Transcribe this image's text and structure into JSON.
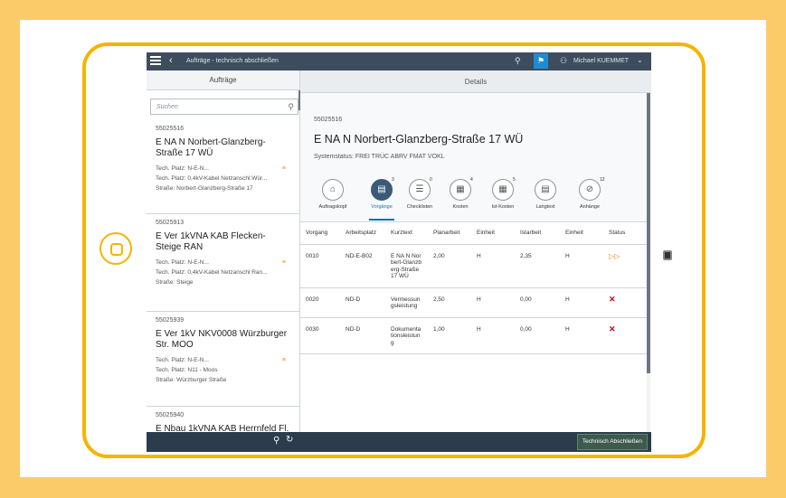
{
  "shell": {
    "title": "Aufträge - technisch abschließen",
    "user": "Michael KUEMMET",
    "back_icon": "chevron-left-icon",
    "flag_icon": "flag-icon"
  },
  "master": {
    "header": "Aufträge",
    "search_placeholder": "Suchen",
    "items": [
      {
        "num": "55025516",
        "title": "E NA N Norbert-Glanzberg-Straße 17 WÜ",
        "l1": "Tech. Platz: N-E-N...",
        "l2": "Tech. Platz: 0,4kV-Kabel Netzanschl.Wür...",
        "l3": "Straße: Norbert-Glanzberg-Straße 17",
        "ord": "≡"
      },
      {
        "num": "55025913",
        "title": "E Ver 1kVNA KAB Flecken-Steige RAN",
        "l1": "Tech. Platz: N-E-N...",
        "l2": "Tech. Platz: 0,4kV-Kabel Netzanschl Ran...",
        "l3": "Straße: Steige",
        "ord": "≡"
      },
      {
        "num": "55025939",
        "title": "E Ver 1kV NKV0008 Würzburger Str. MOO",
        "l1": "Tech. Platz: N-E-N...",
        "l2": "Tech. Platz: N11 - Moos",
        "l3": "Straße: Würzburger Straße",
        "ord": "≡"
      },
      {
        "num": "55025940",
        "title": "E Nbau 1kVNA KAB Herrnfeld Fl.",
        "l1": "",
        "l2": "",
        "l3": "",
        "ord": ""
      }
    ]
  },
  "detail": {
    "header": "Details",
    "number": "55025516",
    "title": "E NA N Norbert-Glanzberg-Straße 17 WÜ",
    "status": "Systemstatus: FREI TRÜC ABRV FMAT VOKL",
    "tabs": [
      {
        "label": "Auftragskopf",
        "count": "",
        "icon": "⌂"
      },
      {
        "label": "Vorgänge",
        "count": "3",
        "icon": "▤"
      },
      {
        "label": "Checklisten",
        "count": "0",
        "icon": "☰"
      },
      {
        "label": "Kosten",
        "count": "4",
        "icon": "▦"
      },
      {
        "label": "Ist-Kosten",
        "count": "5",
        "icon": "▦"
      },
      {
        "label": "Langtext",
        "count": "",
        "icon": "▤"
      },
      {
        "label": "Anhänge",
        "count": "12",
        "icon": "⊘"
      }
    ],
    "columns": [
      "Vorgang",
      "Arbeitsplatz",
      "Kurztext",
      "Planarbeit",
      "Einheit",
      "Istarbeit",
      "Einheit",
      "Status"
    ],
    "rows": [
      {
        "vorgang": "0010",
        "arbeitsplatz": "ND-E-B02",
        "kurztext": "E NA N Norbert-Glanzberg-Straße 17 WÜ",
        "planarbeit": "2,00",
        "einheit": "H",
        "istarbeit": "2,35",
        "einheit2": "H",
        "status": "▷▷"
      },
      {
        "vorgang": "0020",
        "arbeitsplatz": "ND-D",
        "kurztext": "Vermessungsleistung",
        "planarbeit": "2,50",
        "einheit": "H",
        "istarbeit": "0,00",
        "einheit2": "H",
        "status": "✕"
      },
      {
        "vorgang": "0030",
        "arbeitsplatz": "ND-D",
        "kurztext": "Dokumentationsleistung",
        "planarbeit": "1,00",
        "einheit": "H",
        "istarbeit": "0,00",
        "einheit2": "H",
        "status": "✕"
      }
    ],
    "footer_button": "Technisch Abschließen"
  }
}
